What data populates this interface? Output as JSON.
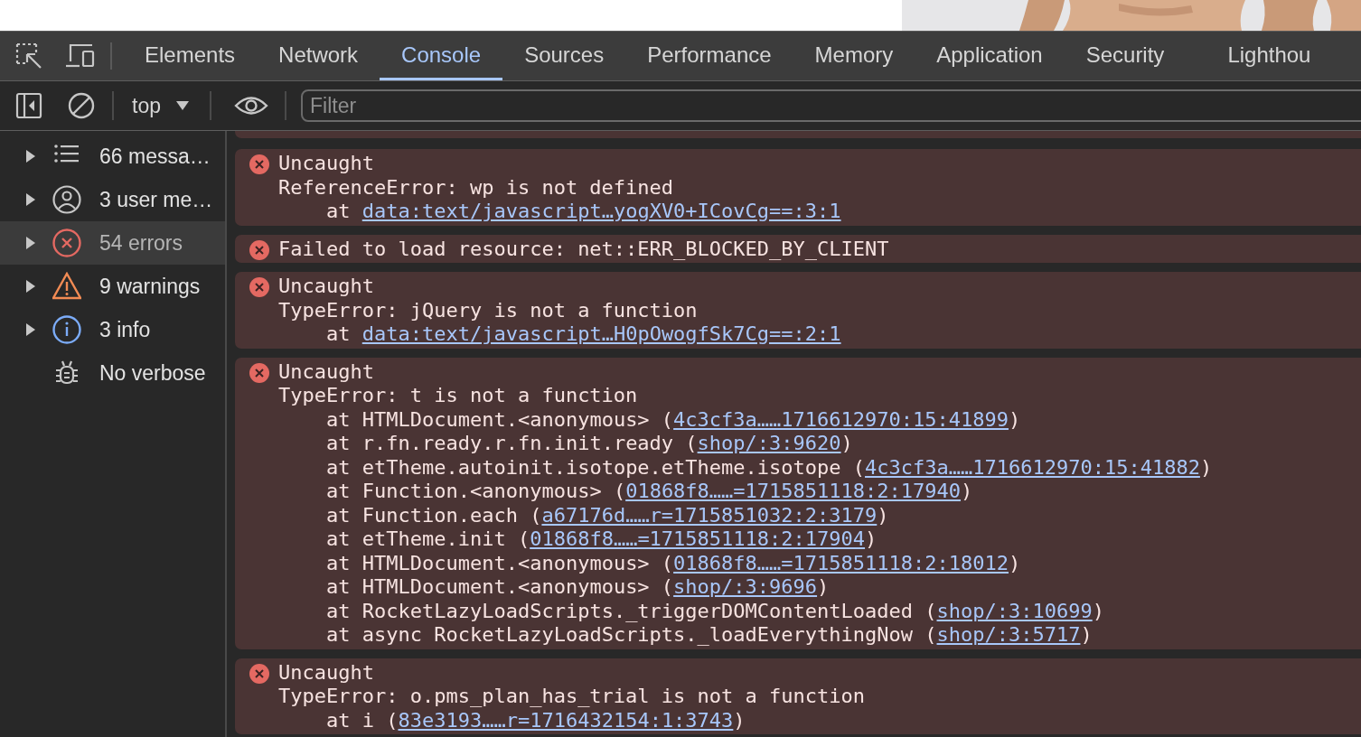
{
  "tabs": [
    {
      "label": "Elements",
      "selected": false
    },
    {
      "label": "Network",
      "selected": false
    },
    {
      "label": "Console",
      "selected": true
    },
    {
      "label": "Sources",
      "selected": false
    },
    {
      "label": "Performance",
      "selected": false
    },
    {
      "label": "Memory",
      "selected": false
    },
    {
      "label": "Application",
      "selected": false
    },
    {
      "label": "Security",
      "selected": false
    },
    {
      "label": "Lighthou",
      "selected": false
    }
  ],
  "toolbar": {
    "context": "top",
    "filter": {
      "placeholder": "Filter"
    }
  },
  "sidebar": {
    "items": [
      {
        "kind": "messages",
        "label": "66 messa…",
        "selected": false,
        "expanded": false
      },
      {
        "kind": "user",
        "label": "3 user me…",
        "selected": false,
        "expanded": false
      },
      {
        "kind": "errors",
        "label": "54 errors",
        "selected": true,
        "expanded": false
      },
      {
        "kind": "warnings",
        "label": "9 warnings",
        "selected": false,
        "expanded": false
      },
      {
        "kind": "info",
        "label": "3 info",
        "selected": false,
        "expanded": false
      },
      {
        "kind": "verbose",
        "label": "No verbose",
        "selected": false
      }
    ]
  },
  "messages": [
    {
      "kind": "error",
      "summary": "Uncaught",
      "detail": "ReferenceError: wp is not defined",
      "stack": [
        {
          "prefix": "at ",
          "link": "data:text/javascript…yogXV0+ICovCg==:3:1"
        }
      ]
    },
    {
      "kind": "error",
      "summary": "Failed to load resource: net::ERR_BLOCKED_BY_CLIENT"
    },
    {
      "kind": "error",
      "summary": "Uncaught",
      "detail": "TypeError: jQuery is not a function",
      "stack": [
        {
          "prefix": "at ",
          "link": "data:text/javascript…H0pOwogfSk7Cg==:2:1"
        }
      ]
    },
    {
      "kind": "error",
      "summary": "Uncaught",
      "detail": "TypeError: t is not a function",
      "stack": [
        {
          "prefix": "at HTMLDocument.<anonymous> (",
          "link": "4c3cf3a……1716612970:15:41899",
          "suffix": ")"
        },
        {
          "prefix": "at r.fn.ready.r.fn.init.ready (",
          "link": "shop/:3:9620",
          "suffix": ")"
        },
        {
          "prefix": "at etTheme.autoinit.isotope.etTheme.isotope (",
          "link": "4c3cf3a……1716612970:15:41882",
          "suffix": ")"
        },
        {
          "prefix": "at Function.<anonymous> (",
          "link": "01868f8……=1715851118:2:17940",
          "suffix": ")"
        },
        {
          "prefix": "at Function.each (",
          "link": "a67176d……r=1715851032:2:3179",
          "suffix": ")"
        },
        {
          "prefix": "at etTheme.init (",
          "link": "01868f8……=1715851118:2:17904",
          "suffix": ")"
        },
        {
          "prefix": "at HTMLDocument.<anonymous> (",
          "link": "01868f8……=1715851118:2:18012",
          "suffix": ")"
        },
        {
          "prefix": "at HTMLDocument.<anonymous> (",
          "link": "shop/:3:9696",
          "suffix": ")"
        },
        {
          "prefix": "at RocketLazyLoadScripts._triggerDOMContentLoaded (",
          "link": "shop/:3:10699",
          "suffix": ")"
        },
        {
          "prefix": "at async RocketLazyLoadScripts._loadEverythingNow (",
          "link": "shop/:3:5717",
          "suffix": ")"
        }
      ]
    },
    {
      "kind": "error",
      "summary": "Uncaught",
      "detail": "TypeError: o.pms_plan_has_trial is not a function",
      "stack": [
        {
          "prefix": "at i (",
          "link": "83e3193……r=1716432154:1:3743",
          "suffix": ")"
        }
      ]
    }
  ]
}
